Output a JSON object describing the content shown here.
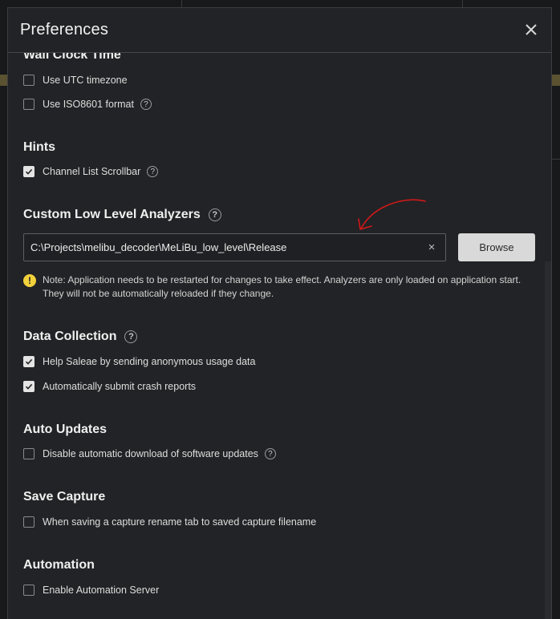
{
  "dialog": {
    "title": "Preferences",
    "close_icon": "close-icon"
  },
  "wall_clock": {
    "title": "Wall Clock Time",
    "items": [
      {
        "label": "Use UTC timezone",
        "checked": false,
        "help": false
      },
      {
        "label": "Use ISO8601 format",
        "checked": false,
        "help": true
      }
    ]
  },
  "hints": {
    "title": "Hints",
    "items": [
      {
        "label": "Channel List Scrollbar",
        "checked": true,
        "help": true
      }
    ]
  },
  "custom_analyzers": {
    "title": "Custom Low Level Analyzers",
    "path_value": "C:\\Projects\\melibu_decoder\\MeLiBu_low_level\\Release",
    "clear_symbol": "×",
    "browse_label": "Browse",
    "note_icon": "!",
    "note": "Note: Application needs to be restarted for changes to take effect. Analyzers are only loaded on application start. They will not be automatically reloaded if they change."
  },
  "data_collection": {
    "title": "Data Collection",
    "items": [
      {
        "label": "Help Saleae by sending anonymous usage data",
        "checked": true,
        "help": false
      },
      {
        "label": "Automatically submit crash reports",
        "checked": true,
        "help": false
      }
    ]
  },
  "auto_updates": {
    "title": "Auto Updates",
    "items": [
      {
        "label": "Disable automatic download of software updates",
        "checked": false,
        "help": true
      }
    ]
  },
  "save_capture": {
    "title": "Save Capture",
    "items": [
      {
        "label": "When saving a capture rename tab to saved capture filename",
        "checked": false,
        "help": false
      }
    ]
  },
  "automation": {
    "title": "Automation",
    "items": [
      {
        "label": "Enable Automation Server",
        "checked": false,
        "help": false
      }
    ]
  },
  "help_symbol": "?",
  "colors": {
    "dialog_bg": "#222326",
    "annotation_arrow": "#d01818",
    "warning": "#f2d23c"
  }
}
